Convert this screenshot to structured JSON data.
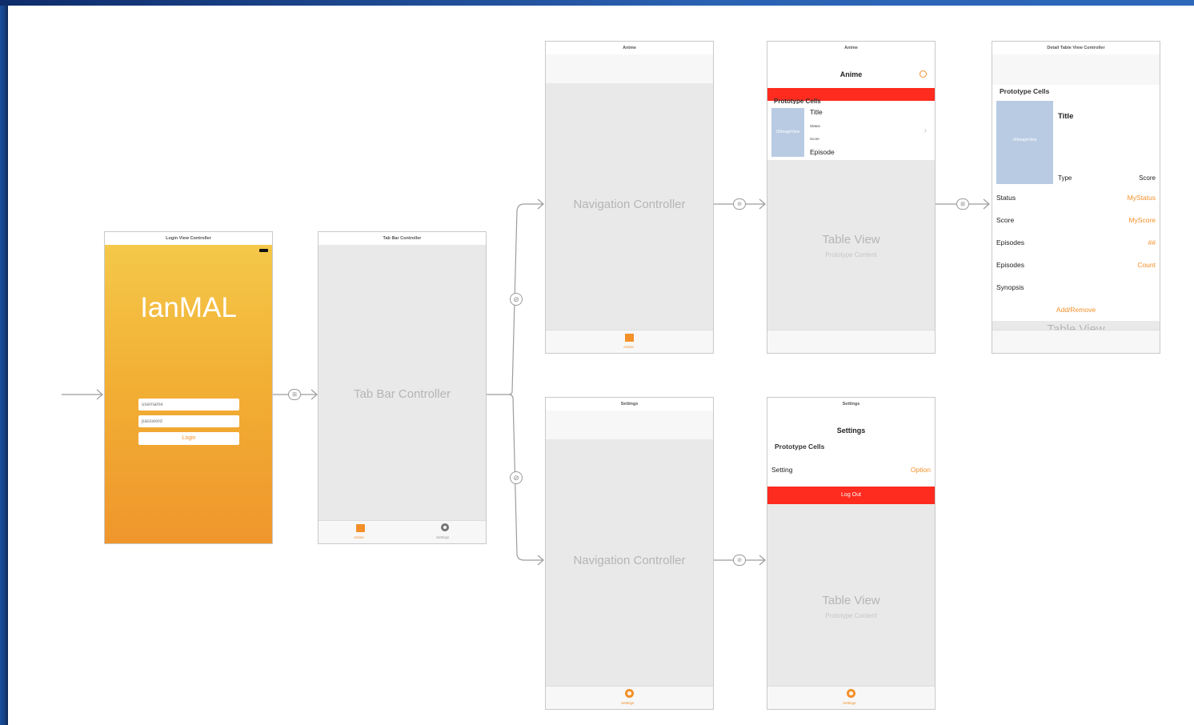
{
  "colors": {
    "accent": "#f3902a",
    "red": "#fe2b1f",
    "login_top": "#f4c84a",
    "login_bottom": "#ef962c",
    "image_placeholder": "#b9cbe3"
  },
  "login": {
    "header": "Login View Controller",
    "app_title": "IanMAL",
    "username_placeholder": "username",
    "password_placeholder": "password",
    "login_button": "Login"
  },
  "tabbar_controller": {
    "header": "Tab Bar Controller",
    "label": "Tab Bar Controller",
    "tab1": "Anime",
    "tab2": "Settings",
    "tab1_icon": "anime-tab-icon",
    "tab2_icon": "gear-icon"
  },
  "nav_top": {
    "header": "Anime",
    "label": "Navigation Controller",
    "tab": "Anime"
  },
  "nav_bottom": {
    "header": "Settings",
    "label": "Navigation Controller",
    "tab": "Settings"
  },
  "anime_table": {
    "header": "Anime",
    "nav_title": "Anime",
    "search_icon": "search-icon",
    "section": "Prototype Cells",
    "image_label": "UIImageView",
    "cell_title": "Title",
    "cell_status": "Status",
    "cell_score": "Score",
    "cell_episode": "Episode",
    "table_label": "Table View",
    "table_sub": "Prototype Content"
  },
  "settings_table": {
    "header": "Settings",
    "nav_title": "Settings",
    "section": "Prototype Cells",
    "setting_label": "Setting",
    "setting_value": "Option",
    "logout": "Log Out",
    "table_label": "Table View",
    "table_sub": "Prototype Content",
    "tab": "Settings"
  },
  "detail": {
    "header": "Detail Table View Controller",
    "section": "Prototype Cells",
    "image_label": "UIImageView",
    "title": "Title",
    "type": "Type",
    "score_label": "Score",
    "rows": [
      {
        "label": "Status",
        "value": "MyStatus"
      },
      {
        "label": "Score",
        "value": "MyScore"
      },
      {
        "label": "Episodes",
        "value": "##"
      },
      {
        "label": "Episodes",
        "value": "Count"
      },
      {
        "label": "Synopsis",
        "value": ""
      }
    ],
    "add_remove": "Add/Remove",
    "table_label": "Table View"
  }
}
